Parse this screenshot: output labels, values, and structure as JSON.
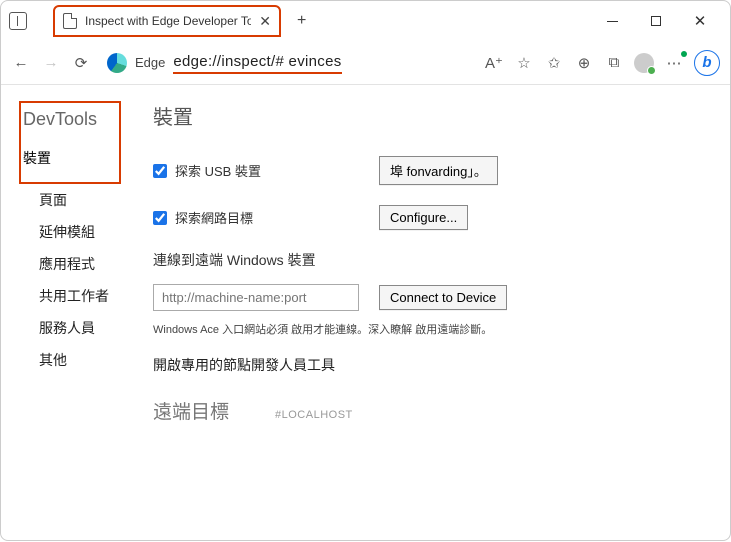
{
  "window": {
    "tab_title": "Inspect with Edge Developer To",
    "new_tab": "+",
    "minimize": "–",
    "close": "✕"
  },
  "toolbar": {
    "edge_label": "Edge",
    "url_prefix": "|",
    "url": "edge://inspect/#",
    "url_suffix": " evinces",
    "reader_icon": "A⁺",
    "bing_label": "b"
  },
  "sidebar": {
    "title": "DevTools",
    "items": [
      "裝置",
      "頁面",
      "延伸模組",
      "應用程式",
      "共用工作者",
      "服務人員",
      "其他"
    ],
    "active_index": 0
  },
  "main": {
    "heading": "裝置",
    "usb_label": "探索 USB 裝置",
    "usb_button": "埠 fonvarding」。",
    "net_label": "探索網路目標",
    "net_button": "Configure...",
    "connect_heading": "連線到遠端 Windows 裝置",
    "connect_placeholder": "http://machine-name:port",
    "connect_button": "Connect to Device",
    "note": "Windows Ace 入口網站必須 啟用才能連線。深入瞭解 啟用遠端診斷。",
    "node_tools": "開啟專用的節點開發人員工具",
    "remote_heading": "遠端目標",
    "remote_tag": "#LOCALHOST"
  }
}
